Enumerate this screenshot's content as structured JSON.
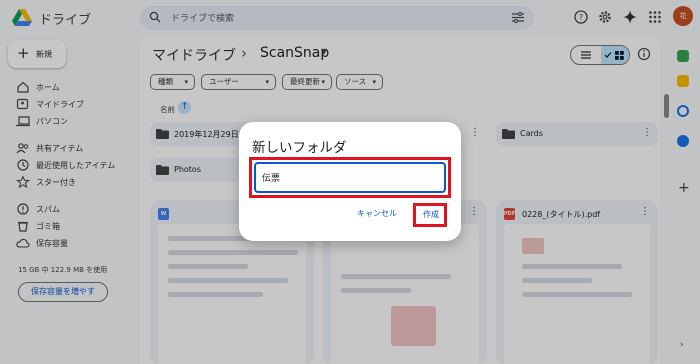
{
  "app": {
    "name": "ドライブ"
  },
  "search": {
    "placeholder": "ドライブで検索"
  },
  "avatar": {
    "initials": "花"
  },
  "sidebar": {
    "new_label": "新規",
    "items": [
      {
        "label": "ホーム",
        "icon": "home-icon"
      },
      {
        "label": "マイドライブ",
        "icon": "my-drive-icon"
      },
      {
        "label": "パソコン",
        "icon": "computer-icon"
      },
      {
        "label": "共有アイテム",
        "icon": "shared-icon"
      },
      {
        "label": "最近使用したアイテム",
        "icon": "recent-icon"
      },
      {
        "label": "スター付き",
        "icon": "star-icon"
      },
      {
        "label": "スパム",
        "icon": "spam-icon"
      },
      {
        "label": "ゴミ箱",
        "icon": "trash-icon"
      },
      {
        "label": "保存容量",
        "icon": "cloud-icon"
      }
    ],
    "storage_text": "15 GB 中 122.9 MB を使用",
    "storage_button": "保存容量を増やす"
  },
  "breadcrumb": {
    "root": "マイドライブ",
    "current": "ScanSnap"
  },
  "filters": [
    "種類",
    "ユーザー",
    "最終更新",
    "ソース"
  ],
  "sort": {
    "label": "名前"
  },
  "folders": [
    {
      "name": "2019年12月29日2"
    },
    {
      "name": "Cards"
    },
    {
      "name": "Photos"
    }
  ],
  "files": [
    {
      "name": "",
      "type": "W",
      "color": "#4285f4"
    },
    {
      "name": "",
      "type": "",
      "color": "#4285f4"
    },
    {
      "name": "0228_(タイトル).pdf",
      "type": "PDF",
      "color": "#ea4335"
    }
  ],
  "dialog": {
    "title": "新しいフォルダ",
    "input_value": "伝票",
    "cancel_label": "キャンセル",
    "create_label": "作成"
  },
  "colors": {
    "accent": "#0b57d0",
    "highlight": "#e0141e",
    "selected": "#c2e7ff"
  }
}
